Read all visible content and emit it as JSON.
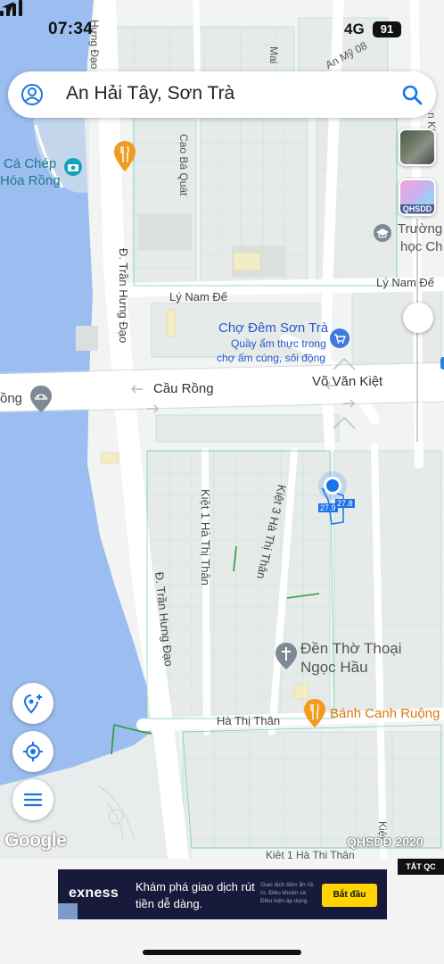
{
  "status": {
    "time": "07:34",
    "network": "4G",
    "battery": "91"
  },
  "search": {
    "query": "An Hải Tây, Sơn Trà"
  },
  "layers": {
    "qhsdd_label": "QHSDD"
  },
  "map": {
    "streets": {
      "tran_hung_dao_top": "Đ. Trần Hưng Đạo",
      "tran_hung_dao_bottom": "Đ. Trần Hưng Đạo",
      "ly_nam_de_left": "Lý Nam Đế",
      "ly_nam_de_right": "Lý Nam Đế",
      "cau_rong": "Cầu Rồng",
      "vo_van_kiet": "Võ Văn Kiệt",
      "cao_ba_quat": "Cao Bá Quát",
      "an_my_08": "An Mỹ 08",
      "kiet_1_ha_thi_than": "Kiệt 1 Hà Thị Thân",
      "kiet_3_ha_thi_than": "Kiệt 3 Hà Thị Thân",
      "ha_thi_than": "Hà Thị Thân",
      "kiet_1_ha_thi_than_bottom": "Kiệt 1 Hà Thị Thân",
      "mai_partial": "Mai",
      "hung_dao_partial": "Hưng Đạo",
      "nguyen_khanh_partial": "n Khánh",
      "kiet_partial": "Kiệt"
    },
    "places": {
      "ca_chep_line1": "Cá Chép",
      "ca_chep_line2": "Hóa Rồng",
      "cho_dem_name": "Chợ Đêm Sơn Trà",
      "cho_dem_desc_line1": "Quầy ẩm thực trong",
      "cho_dem_desc_line2": "chợ ấm cúng, sôi động",
      "den_tho_line1": "Đền Thờ Thoại",
      "den_tho_line2": "Ngọc Hầu",
      "banh_canh": "Bánh Canh Ruộng",
      "truong_line1": "Trường",
      "truong_line2": "học Ch",
      "rong_partial": "ồng"
    },
    "parcel": {
      "dim_a": "27.9",
      "dim_b": "27.8"
    },
    "credit": "QHSDĐ 2020",
    "google": "Google"
  },
  "ad": {
    "close_label": "TẮT QC",
    "brand": "exness",
    "headline": "Khám phá giao dịch rút tiền dễ dàng.",
    "fine_print": "Giao dịch tiềm ẩn rủi ro. Điều khoản và Điều kiện áp dụng.",
    "cta": "Bắt đầu"
  },
  "colors": {
    "water": "#9cbdf0",
    "accent": "#1a73e8",
    "parcel_line": "#5cc6b0",
    "marker_orange": "#f29c1f"
  }
}
